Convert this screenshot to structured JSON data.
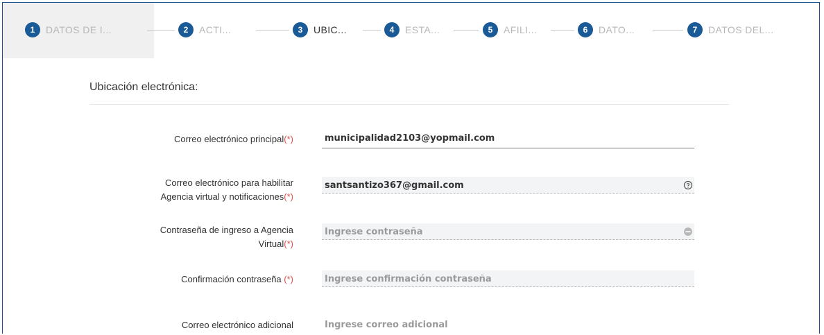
{
  "stepper": {
    "steps": [
      {
        "number": "1",
        "label": "DATOS DE I..."
      },
      {
        "number": "2",
        "label": "ACTI..."
      },
      {
        "number": "3",
        "label": "UBIC..."
      },
      {
        "number": "4",
        "label": "ESTA..."
      },
      {
        "number": "5",
        "label": "AFILI..."
      },
      {
        "number": "6",
        "label": "DATO..."
      },
      {
        "number": "7",
        "label": "DATOS DEL..."
      }
    ],
    "step_color": "#1a5a96"
  },
  "section": {
    "title": "Ubicación electrónica:"
  },
  "form": {
    "required_mark": "(*)",
    "email_principal": {
      "label": "Correo electrónico principal",
      "value": "municipalidad2103@yopmail.com"
    },
    "email_agencia": {
      "label_line1": "Correo electrónico para habilitar",
      "label_line2": "Agencia virtual y notificaciones",
      "value": "santsantizo367@gmail.com",
      "icon": "help-circle-icon"
    },
    "password": {
      "label_line1": "Contraseña de ingreso a Agencia",
      "label_line2": "Virtual",
      "placeholder": "Ingrese contraseña",
      "icon": "minus-circle-icon"
    },
    "password_confirm": {
      "label": "Confirmación contraseña ",
      "placeholder": "Ingrese confirmación contraseña"
    },
    "email_adicional": {
      "label": "Correo electrónico adicional",
      "placeholder": "Ingrese correo adicional"
    }
  }
}
